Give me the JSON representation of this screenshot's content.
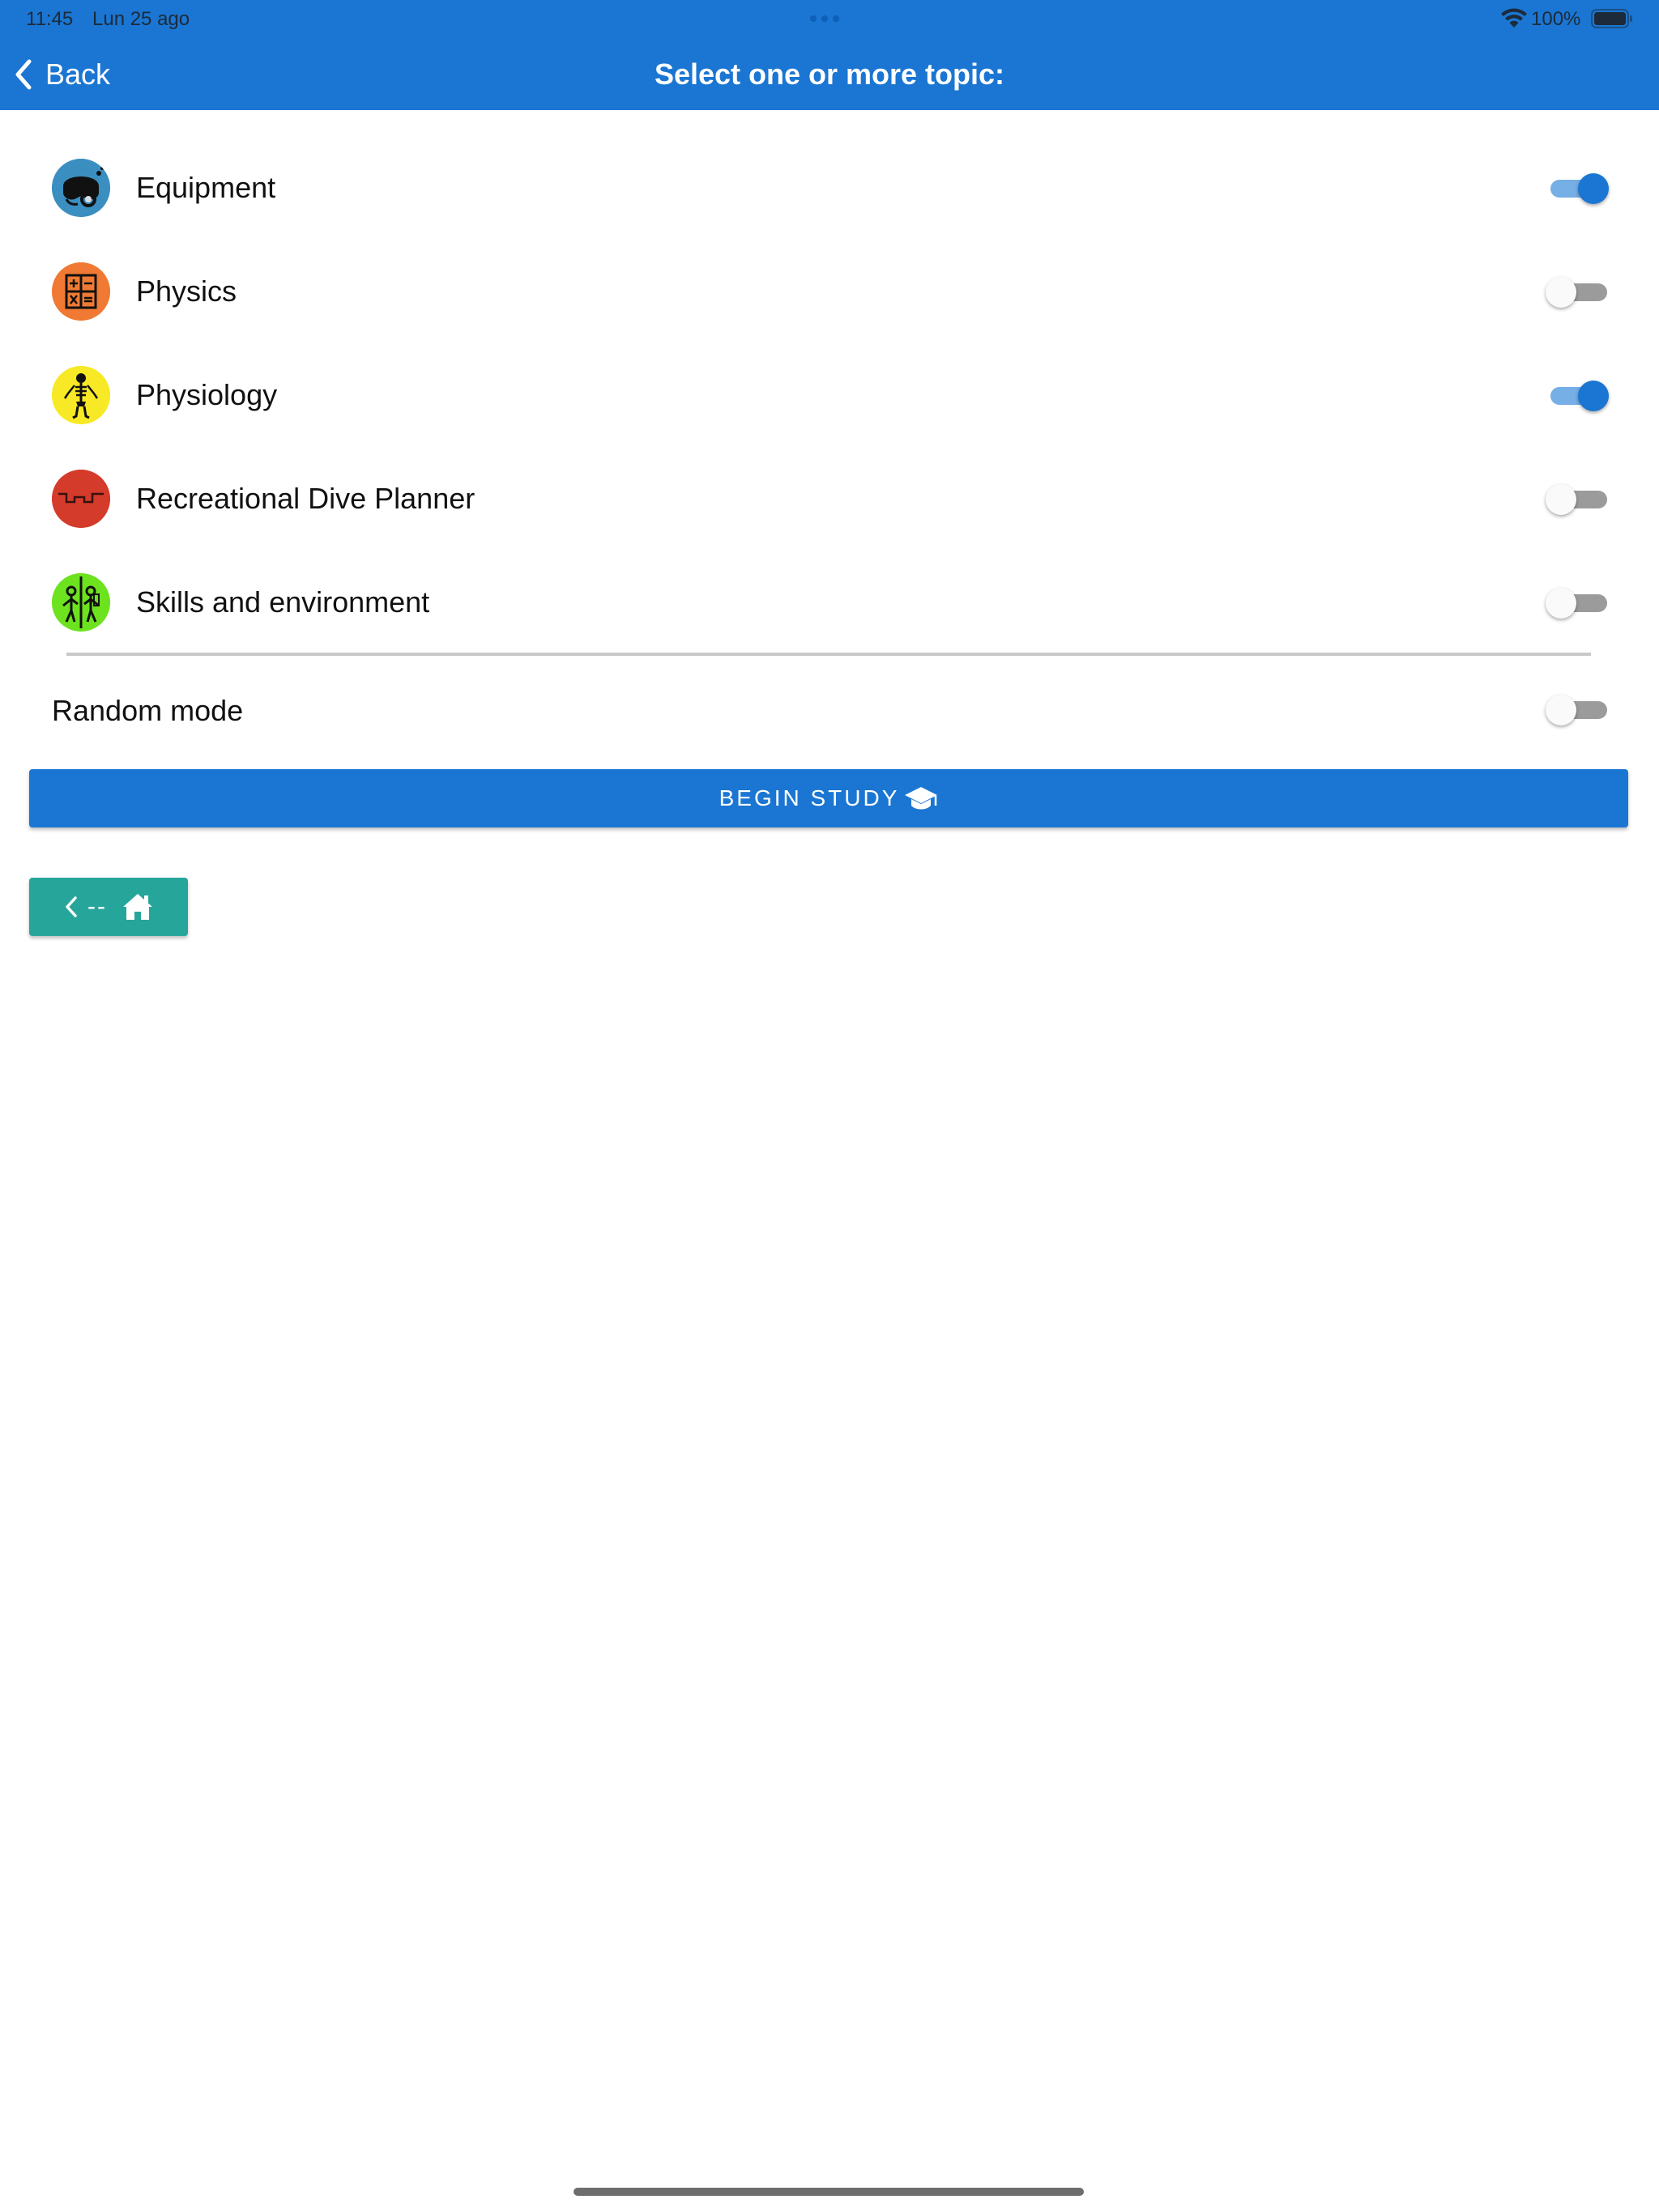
{
  "status_bar": {
    "time": "11:45",
    "date": "Lun 25 ago",
    "battery": "100%"
  },
  "nav": {
    "back_label": "Back",
    "title": "Select one or more topic:"
  },
  "topics": [
    {
      "label": "Equipment",
      "icon": "diving-mask-icon",
      "color": "#3b8fc0",
      "enabled": true
    },
    {
      "label": "Physics",
      "icon": "calculator-icon",
      "color": "#f07a33",
      "enabled": false
    },
    {
      "label": "Physiology",
      "icon": "skeleton-icon",
      "color": "#f7e925",
      "enabled": true
    },
    {
      "label": "Recreational Dive Planner",
      "icon": "dive-profile-icon",
      "color": "#d43b2a",
      "enabled": false
    },
    {
      "label": "Skills and environment",
      "icon": "divers-icon",
      "color": "#6de21f",
      "enabled": false
    }
  ],
  "random_mode": {
    "label": "Random mode",
    "enabled": false
  },
  "begin_button": {
    "label": "BEGIN STUDY",
    "icon": "graduation-cap-icon"
  },
  "home_button": {
    "text": "--",
    "icon": "home-icon"
  },
  "colors": {
    "primary": "#1a76d2",
    "home_button": "#26a69a",
    "toggle_on_track": "#76aee6",
    "toggle_off_track": "#9b9b9b"
  }
}
